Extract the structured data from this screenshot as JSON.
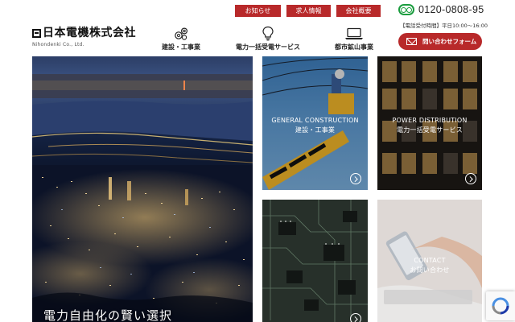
{
  "header": {
    "logo_text": "日本電機株式会社",
    "logo_sub": "Nihondenki Co., Ltd.",
    "top_links": [
      "お知らせ",
      "求人情報",
      "会社概要"
    ],
    "phone_number": "0120-0808-95",
    "phone_hours": "【電話受付時間】平日10:00〜16:00",
    "contact_button": "問い合わせフォーム",
    "nav": [
      {
        "label": "建設・工事業",
        "icon": "gears-icon"
      },
      {
        "label": "電力一括受電サービス",
        "icon": "lightbulb-icon"
      },
      {
        "label": "都市鉱山事業",
        "icon": "laptop-icon"
      }
    ]
  },
  "hero": {
    "caption": "電力自由化の賢い選択"
  },
  "tiles": [
    {
      "en": "GENERAL CONSTRUCTION",
      "ja": "建設・工事業"
    },
    {
      "en": "POWER DISTRIBUTION",
      "ja": "電力一括受電サービス"
    },
    {
      "en": "",
      "ja": ""
    },
    {
      "en": "CONTACT",
      "ja": "お問い合わせ"
    }
  ],
  "colors": {
    "accent": "#b8292a",
    "freedial_green": "#1a9c3e"
  }
}
